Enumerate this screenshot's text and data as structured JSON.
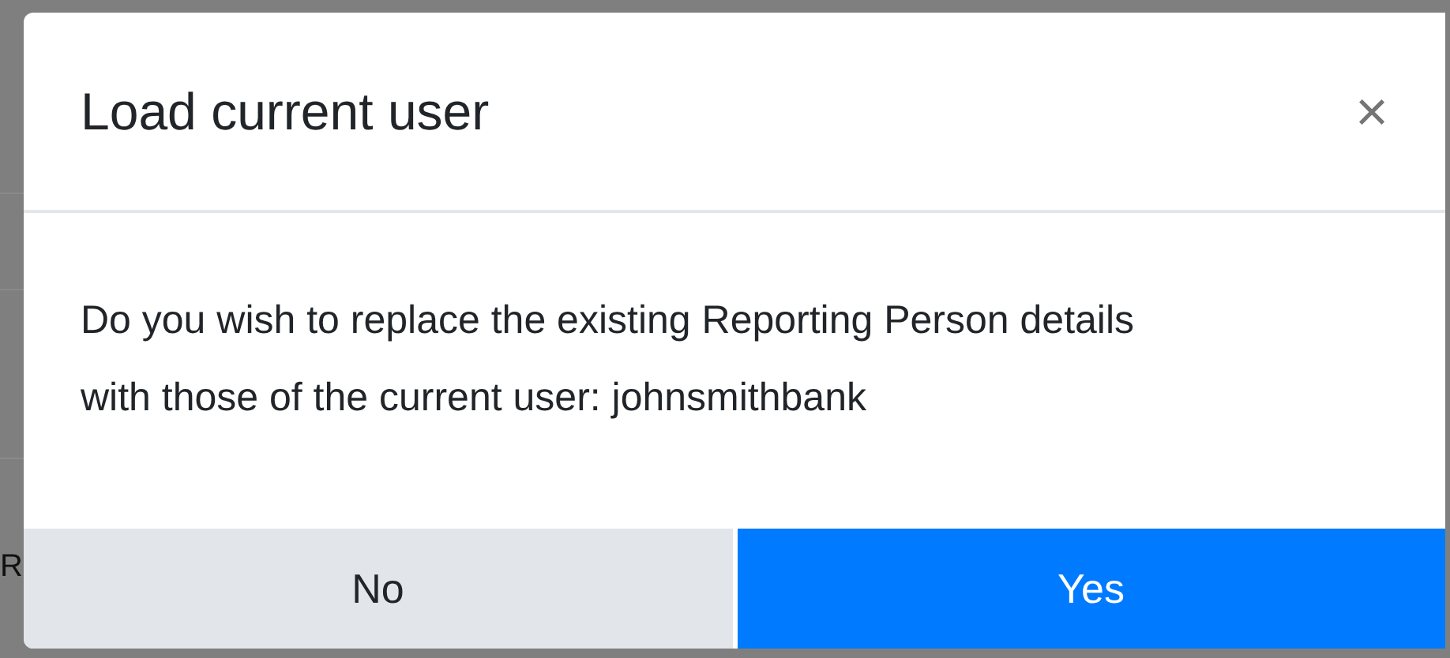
{
  "backdrop": {
    "text_fragment": "R"
  },
  "dialog": {
    "title": "Load current user",
    "close": "×",
    "message": "Do you wish to replace the existing Reporting Person details with those of the current user: johnsmithbank",
    "buttons": [
      {
        "label": "No",
        "kind": "secondary"
      },
      {
        "label": "Yes",
        "kind": "primary"
      }
    ]
  }
}
